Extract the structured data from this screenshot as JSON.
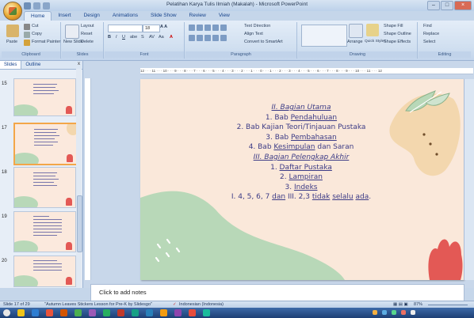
{
  "window": {
    "title": "Pelatihan Karya Tulis Ilmiah (Makalah) - Microsoft PowerPoint"
  },
  "ribbon": {
    "tabs": [
      "Home",
      "Insert",
      "Design",
      "Animations",
      "Slide Show",
      "Review",
      "View"
    ],
    "clipboard": {
      "paste": "Paste",
      "cut": "Cut",
      "copy": "Copy",
      "format_painter": "Format Painter",
      "label": "Clipboard"
    },
    "slides": {
      "new_slide": "New Slide",
      "layout": "Layout",
      "reset": "Reset",
      "delete": "Delete",
      "label": "Slides"
    },
    "font": {
      "size": "18",
      "label": "Font"
    },
    "paragraph": {
      "text_direction": "Text Direction",
      "align_text": "Align Text",
      "convert": "Convert to SmartArt",
      "label": "Paragraph"
    },
    "drawing": {
      "arrange": "Arrange",
      "quick_styles": "Quick Styles",
      "shape_fill": "Shape Fill",
      "shape_outline": "Shape Outline",
      "shape_effects": "Shape Effects",
      "label": "Drawing"
    },
    "editing": {
      "find": "Find",
      "replace": "Replace",
      "select": "Select",
      "label": "Editing"
    }
  },
  "pane": {
    "tab_slides": "Slides",
    "tab_outline": "Outline",
    "close": "x",
    "slide_numbers": [
      "15",
      "",
      "17",
      "18",
      "19",
      "20"
    ]
  },
  "ruler": {
    "text": "12 · · · 11 · · · 10 · · · 9 · · · 8 · · · 7 · · · 6 · · · 5 · · · 4 · · · 3 · · · 2 · · · 1 · · · 0 · · · 1 · · · 2 · · · 3 · · · 4 · · · 5 · · · 6 · · · 7 · · · 8 · · · 9 · · · 10 · · · 11 · · · 12"
  },
  "slide": {
    "lines": [
      {
        "plain": "",
        "link": "II. Bagian Utama",
        "suffix": "",
        "italic": true
      },
      {
        "plain": "1. Bab ",
        "link": "Pendahuluan",
        "suffix": "",
        "italic": false
      },
      {
        "plain": "2. Bab Kajian Teori/Tinjauan Pustaka",
        "link": "",
        "suffix": "",
        "italic": false
      },
      {
        "plain": "3. Bab ",
        "link": "Pembahasan",
        "suffix": "",
        "italic": false
      },
      {
        "plain": "4. Bab ",
        "link": "Kesimpulan",
        "suffix": " dan Saran",
        "italic": false
      },
      {
        "plain": "",
        "link": "III. Bagian Pelengkap Akhir",
        "suffix": "",
        "italic": true
      },
      {
        "plain": "1. ",
        "link": "Daftar Pustaka",
        "suffix": "",
        "italic": false
      },
      {
        "plain": "2. ",
        "link": "Lampiran",
        "suffix": "",
        "italic": false
      },
      {
        "plain": "3. ",
        "link": "Indeks",
        "suffix": "",
        "italic": false
      }
    ],
    "last_line": {
      "a": "I. 4, 5, 6, 7 ",
      "b": "dan",
      "c": "  III. 2,3 ",
      "d": "tidak",
      "e": " ",
      "f": "selalu",
      "g": " ",
      "h": "ada",
      "i": "."
    }
  },
  "notes": {
    "placeholder": "Click to add notes"
  },
  "status": {
    "slide_count": "Slide 17 of 29",
    "theme": "\"Autumn Leaves Stickers Lesson for Pre-K by Slidesgo\"",
    "language": "Indonesian (Indonesia)",
    "zoom": "87%"
  },
  "colors": {
    "slide_bg": "#fae8da",
    "slide_text": "#3c3b86",
    "leaf_green": "#b8d8b8",
    "accent_red": "#e35955"
  }
}
